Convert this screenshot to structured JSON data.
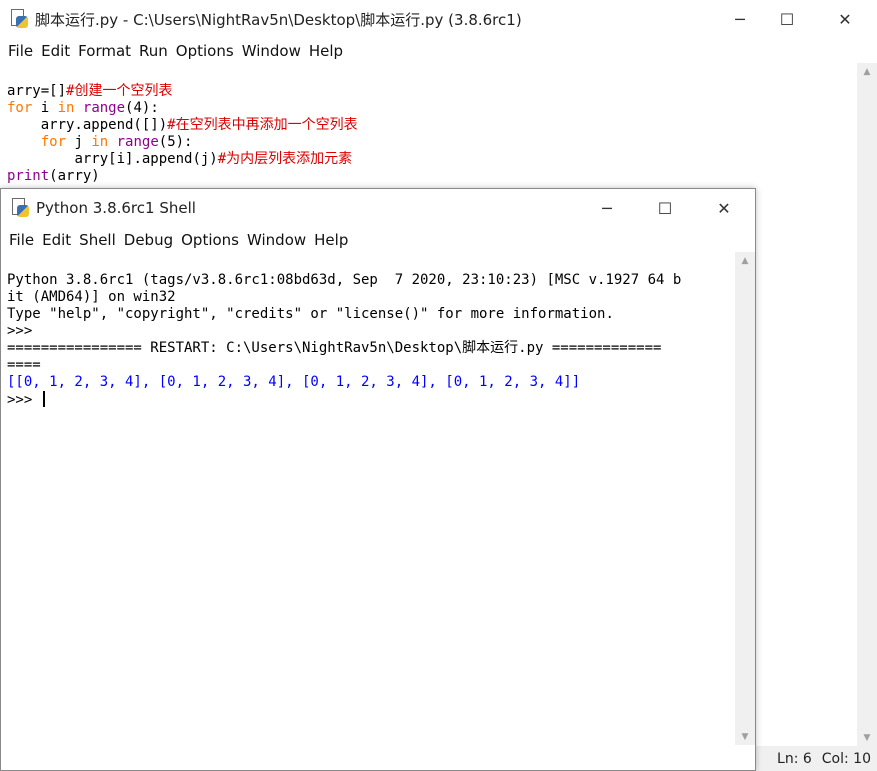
{
  "editor": {
    "title": "脚本运行.py - C:\\Users\\NightRav5n\\Desktop\\脚本运行.py (3.8.6rc1)",
    "menu": [
      "File",
      "Edit",
      "Format",
      "Run",
      "Options",
      "Window",
      "Help"
    ],
    "code": {
      "l1": "arry=[]",
      "l1_comment": "#创建一个空列表",
      "l2_for": "for",
      "l2_mid": " i ",
      "l2_in": "in",
      "l2_range": "range",
      "l2_rest": "(4):",
      "l3_indent": "    ",
      "l3": "arry.append([])",
      "l3_comment": "#在空列表中再添加一个空列表",
      "l4_indent": "    ",
      "l4_for": "for",
      "l4_mid": " j ",
      "l4_in": "in",
      "l4_range": "range",
      "l4_rest": "(5):",
      "l5_indent": "        ",
      "l5": "arry[i].append(j)",
      "l5_comment": "#为内层列表添加元素",
      "l6_print": "print",
      "l6_rest": "(arry)"
    },
    "status": {
      "line": "Ln: 6",
      "col": "Col: 10"
    }
  },
  "shell": {
    "title": "Python 3.8.6rc1 Shell",
    "menu": [
      "File",
      "Edit",
      "Shell",
      "Debug",
      "Options",
      "Window",
      "Help"
    ],
    "lines": {
      "banner1": "Python 3.8.6rc1 (tags/v3.8.6rc1:08bd63d, Sep  7 2020, 23:10:23) [MSC v.1927 64 b",
      "banner2": "it (AMD64)] on win32",
      "banner3": "Type \"help\", \"copyright\", \"credits\" or \"license()\" for more information.",
      "prompt1": ">>> ",
      "restart1": "================ RESTART: C:\\Users\\NightRav5n\\Desktop\\脚本运行.py =============",
      "restart2": "====",
      "output": "[[0, 1, 2, 3, 4], [0, 1, 2, 3, 4], [0, 1, 2, 3, 4], [0, 1, 2, 3, 4]]",
      "prompt2": ">>> "
    }
  },
  "icons": {
    "minimize": "─",
    "maximize": "☐",
    "close": "✕",
    "scroll_up": "▲",
    "scroll_down": "▼"
  }
}
